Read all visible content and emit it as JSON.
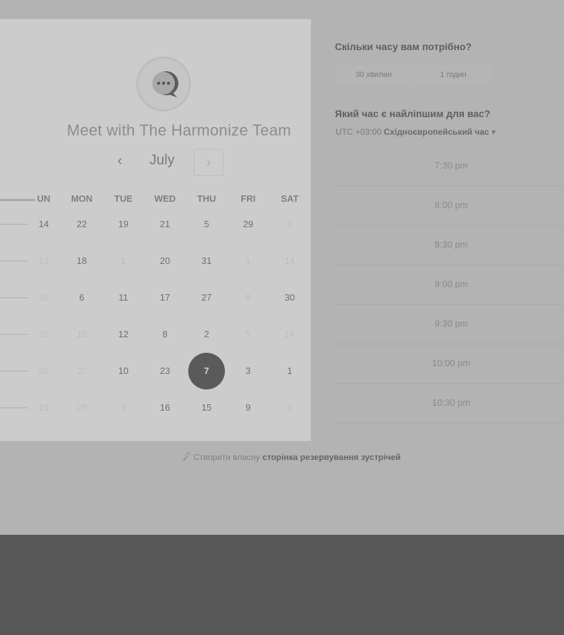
{
  "card": {
    "title": "Meet with The Harmonize Team",
    "month": "July",
    "prev_icon": "‹",
    "next_icon": "›",
    "weekdays": [
      "UN",
      "MON",
      "TUE",
      "WED",
      "THU",
      "FRI",
      "SAT"
    ],
    "weeks": [
      [
        {
          "d": "14",
          "f": false
        },
        {
          "d": "22",
          "f": false
        },
        {
          "d": "19",
          "f": false
        },
        {
          "d": "21",
          "f": false
        },
        {
          "d": "5",
          "f": false
        },
        {
          "d": "29",
          "f": false
        },
        {
          "d": "6",
          "f": true
        }
      ],
      [
        {
          "d": "13",
          "f": true
        },
        {
          "d": "18",
          "f": false
        },
        {
          "d": "1",
          "f": true
        },
        {
          "d": "20",
          "f": false
        },
        {
          "d": "31",
          "f": false
        },
        {
          "d": "1",
          "f": true
        },
        {
          "d": "14",
          "f": true
        }
      ],
      [
        {
          "d": "30",
          "f": true
        },
        {
          "d": "6",
          "f": false
        },
        {
          "d": "11",
          "f": false
        },
        {
          "d": "17",
          "f": false
        },
        {
          "d": "27",
          "f": false
        },
        {
          "d": "8",
          "f": true
        },
        {
          "d": "30",
          "f": false
        }
      ],
      [
        {
          "d": "30",
          "f": true
        },
        {
          "d": "18",
          "f": true
        },
        {
          "d": "12",
          "f": false
        },
        {
          "d": "8",
          "f": false
        },
        {
          "d": "2",
          "f": false
        },
        {
          "d": "5",
          "f": true
        },
        {
          "d": "14",
          "f": true
        }
      ],
      [
        {
          "d": "26",
          "f": true
        },
        {
          "d": "20",
          "f": true
        },
        {
          "d": "10",
          "f": false
        },
        {
          "d": "23",
          "f": false
        },
        {
          "d": "7",
          "f": false,
          "selected": true
        },
        {
          "d": "3",
          "f": false
        },
        {
          "d": "1",
          "f": false
        }
      ],
      [
        {
          "d": "19",
          "f": true
        },
        {
          "d": "28",
          "f": true
        },
        {
          "d": "9",
          "f": true
        },
        {
          "d": "16",
          "f": false
        },
        {
          "d": "15",
          "f": false
        },
        {
          "d": "9",
          "f": false
        },
        {
          "d": "5",
          "f": true
        }
      ]
    ]
  },
  "right": {
    "duration_question": "Скільки часу вам потрібно?",
    "durations": [
      "30 хвилин",
      "1 годин"
    ],
    "time_question": "Який час є найліпшим для вас?",
    "tz_prefix": "UTC +03:00",
    "tz_name": "Східноєвропейський час",
    "tz_caret": "▾",
    "slots": [
      "7:30 pm",
      "8:00 pm",
      "8:30 pm",
      "9:00 pm",
      "9:30 pm",
      "10:00 pm",
      "10:30 pm"
    ]
  },
  "footer": {
    "icon": "magic-wand-icon",
    "prefix": "Створити власну",
    "link": "сторінка резервування зустрічей"
  },
  "colors": {
    "selected_day": "#5a5a5a",
    "background": "#b3b3b3",
    "card": "#cccccc",
    "bottom_bar": "#575757"
  }
}
